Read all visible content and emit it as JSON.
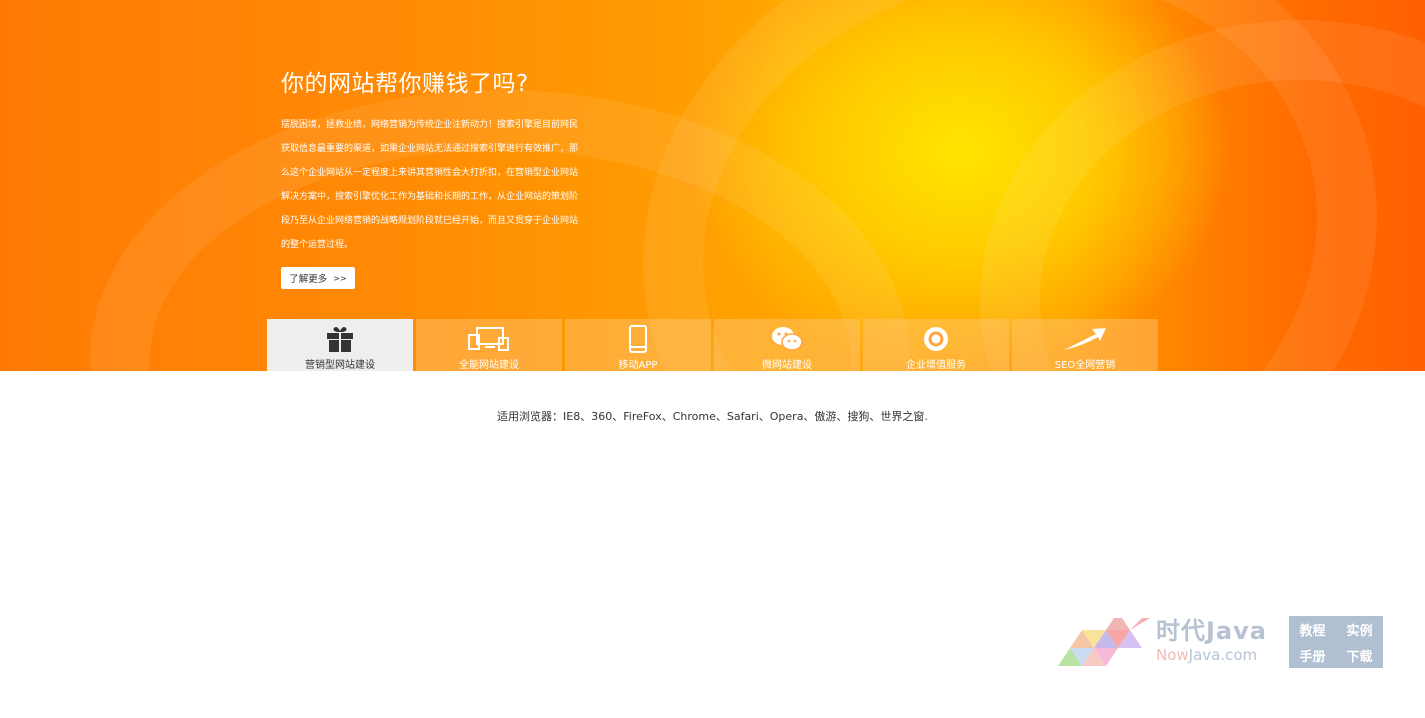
{
  "banner": {
    "headline": "你的网站帮你赚钱了吗?",
    "description_lines": [
      "摆脱困境，拯救业绩，网络营销为传统企业注新动力！搜索引擎是目前网民",
      "获取信息最重要的渠道，如果企业网站无法通过搜索引擎进行有效推广，那",
      "么这个企业网站从一定程度上来讲其营销性会大打折扣，在营销型企业网站",
      "解决方案中，搜索引擎优化工作为基础和长期的工作，从企业网站的策划阶",
      "段乃至从企业网络营销的战略规划阶段就已经开始，而且又贯穿于企业网站",
      "的整个运营过程。"
    ],
    "more_button": "了解更多",
    "more_button_chevron": ">>",
    "colors": {
      "orange": "#ff8c05",
      "yellow": "#ffe400",
      "deep_orange": "#ff6000"
    }
  },
  "tabs": [
    {
      "label": "营销型网站建设",
      "icon": "gift-icon",
      "active": true
    },
    {
      "label": "全能网站建设",
      "icon": "devices-icon",
      "active": false
    },
    {
      "label": "移动APP",
      "icon": "mobile-icon",
      "active": false
    },
    {
      "label": "微网站建设",
      "icon": "wechat-icon",
      "active": false
    },
    {
      "label": "企业增值服务",
      "icon": "target-icon",
      "active": false
    },
    {
      "label": "SEO全网营销",
      "icon": "trend-arrow-icon",
      "active": false
    }
  ],
  "footer": {
    "browser_note": "适用浏览器：IE8、360、FireFox、Chrome、Safari、Opera、傲游、搜狗、世界之窗."
  },
  "watermark": {
    "brand_cn": "时代Java",
    "brand_en_prefix": "Now",
    "brand_en_suffix": "Java.com",
    "links": [
      "教程",
      "实例",
      "手册",
      "下载"
    ]
  }
}
